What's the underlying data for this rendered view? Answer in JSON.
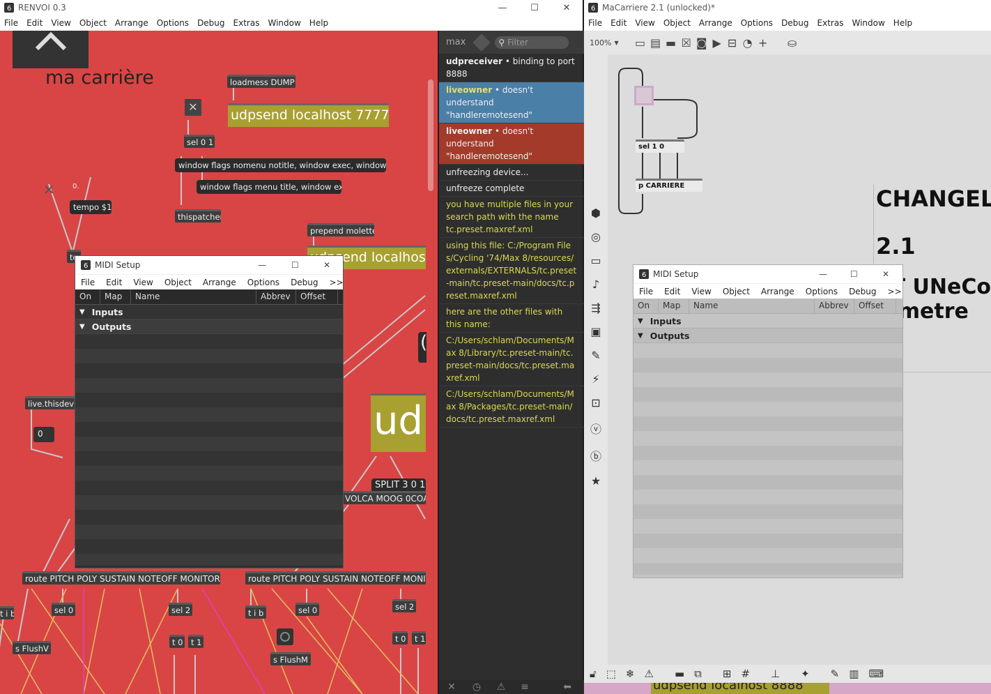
{
  "left_window": {
    "title": "RENVOI 0.3",
    "menu": [
      "File",
      "Edit",
      "View",
      "Object",
      "Arrange",
      "Options",
      "Debug",
      "Extras",
      "Window",
      "Help"
    ],
    "patch": {
      "heading": "ma carrière",
      "objects": {
        "loadmess": "loadmess DUMP",
        "udpsend7777": "udpsend localhost 7777",
        "sel01": "sel 0 1",
        "wflags1": "window flags nomenu notitle, window exec, window exe",
        "wflags2": "window flags menu title, window exec",
        "thispatcher": "thispatcher",
        "tempo": "tempo $1",
        "zero_label": "0.",
        "prepend": "prepend molette",
        "udpsend_partial": "udpsend localhos",
        "live": "live.thisdevic",
        "num0": "0",
        "ud": "ud",
        "split": "SPLIT 3 0 1",
        "volca": "VOLCA MOOG 0COA",
        "route1": "route PITCH POLY SUSTAIN NOTEOFF MONITOR",
        "route2": "route PITCH POLY SUSTAIN NOTEOFF MONIT",
        "tib1": "t i b",
        "sel0a": "sel 0",
        "sel2a": "sel 2",
        "t0a": "t 0",
        "t1a": "t 1",
        "flushv": "s FlushV",
        "tib2": "t i b",
        "sel0b": "sel 0",
        "sel2b": "sel 2",
        "t0b": "t 0",
        "t1b": "t 1",
        "flushm": "s FlushM",
        "te_partial": "te",
        "paren": "("
      }
    }
  },
  "console": {
    "label": "max",
    "filter_placeholder": "Filter",
    "rows": [
      {
        "src": "udpreceiver",
        "text": "• binding to port 8888",
        "kind": "plain"
      },
      {
        "src": "liveowner",
        "text": "• doesn't understand \"handleremotesend\"",
        "kind": "blue"
      },
      {
        "src": "liveowner",
        "text": "• doesn't understand \"handleremotesend\"",
        "kind": "red"
      },
      {
        "src": "",
        "text": "unfreezing device...",
        "kind": "plain"
      },
      {
        "src": "",
        "text": "unfreeze complete",
        "kind": "plain"
      },
      {
        "src": "",
        "text": "you have multiple files in your search path with the name tc.preset.maxref.xml",
        "kind": "yel"
      },
      {
        "src": "",
        "text": "  using this file: C:/Program Files/Cycling '74/Max 8/resources/externals/EXTERNALS/tc.preset-main/tc.preset-main/docs/tc.preset.maxref.xml",
        "kind": "yel"
      },
      {
        "src": "",
        "text": "here are the other files with this name:",
        "kind": "yel"
      },
      {
        "src": "",
        "text": "  C:/Users/schlam/Documents/Max 8/Library/tc.preset-main/tc.preset-main/docs/tc.preset.maxref.xml",
        "kind": "yel"
      },
      {
        "src": "",
        "text": "  C:/Users/schlam/Documents/Max 8/Packages/tc.preset-main/docs/tc.preset.maxref.xml",
        "kind": "yel"
      }
    ]
  },
  "right_window": {
    "title": "MaCarriere 2.1 (unlocked)*",
    "menu": [
      "File",
      "Edit",
      "View",
      "Object",
      "Arrange",
      "Options",
      "Debug",
      "Extras",
      "Window",
      "Help"
    ],
    "zoom": "100%",
    "objects": {
      "sel10": "sel 1 0",
      "pcarriere": "p CARRIERE"
    },
    "changelog": {
      "title": "CHANGELO",
      "version": "2.1",
      "line1": "ST UNeCo",
      "line2": "u metre"
    },
    "bottom_msg": "udpsend localhost 8888"
  },
  "midi_left": {
    "title": "MIDI Setup",
    "menu": [
      "File",
      "Edit",
      "View",
      "Object",
      "Arrange",
      "Options",
      "Debug",
      ">>"
    ],
    "columns": [
      "On",
      "Map",
      "Name",
      "Abbrev",
      "Offset"
    ],
    "groups": [
      "Inputs",
      "Outputs"
    ]
  },
  "midi_right": {
    "title": "MIDI Setup",
    "menu": [
      "File",
      "Edit",
      "View",
      "Object",
      "Arrange",
      "Options",
      "Debug",
      ">>"
    ],
    "columns": [
      "On",
      "Map",
      "Name",
      "Abbrev",
      "Offset"
    ],
    "groups": [
      "Inputs",
      "Outputs"
    ]
  },
  "colors": {
    "patch_bg": "#d94545",
    "console_bg": "#2e2e2e",
    "yellow_text": "#d9d94f",
    "blue_row": "#4a7fa8",
    "red_row": "#a33a2a",
    "object_bg": "#3d3d3d"
  }
}
